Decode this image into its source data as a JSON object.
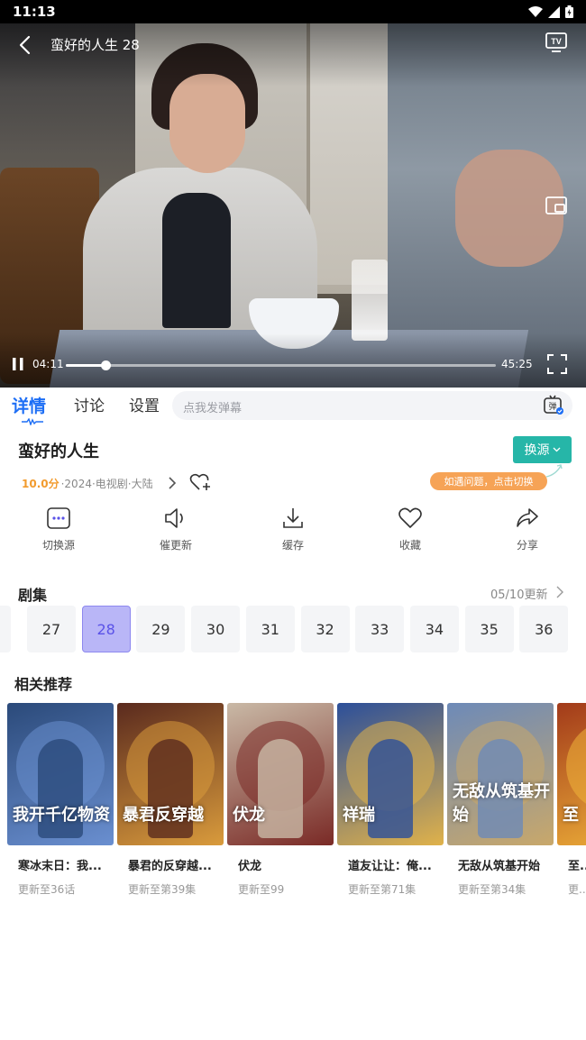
{
  "status_bar": {
    "time": "11:13"
  },
  "player": {
    "title": "蛮好的人生 28",
    "current_time": "04:11",
    "total_time": "45:25",
    "progress": 0.092
  },
  "tabs": {
    "items": [
      {
        "label": "详情",
        "active": true
      },
      {
        "label": "讨论",
        "active": false
      },
      {
        "label": "设置",
        "active": false
      }
    ],
    "danmu_placeholder": "点我发弹幕"
  },
  "show": {
    "title": "蛮好的人生",
    "source_button": "换源",
    "score": "10.0分",
    "meta": "·2024·电视剧·大陆",
    "hint": "如遇问题，点击切换"
  },
  "actions": [
    {
      "label": "切换源",
      "icon": "switch-source-icon"
    },
    {
      "label": "催更新",
      "icon": "speaker-icon"
    },
    {
      "label": "缓存",
      "icon": "download-icon"
    },
    {
      "label": "收藏",
      "icon": "heart-icon"
    },
    {
      "label": "分享",
      "icon": "share-icon"
    }
  ],
  "episodes": {
    "heading": "剧集",
    "update_text": "05/10更新",
    "list": [
      "27",
      "28",
      "29",
      "30",
      "31",
      "32",
      "33",
      "34",
      "35",
      "36"
    ],
    "current": "28"
  },
  "recommendations": {
    "heading": "相关推荐",
    "items": [
      {
        "title": "寒冰末日：我...",
        "subtitle": "更新至36话",
        "poster_text": "我开千亿物资",
        "colors": [
          "#2b4a7a",
          "#6a8fd0"
        ]
      },
      {
        "title": "暴君的反穿越...",
        "subtitle": "更新至第39集",
        "poster_text": "暴君反穿越",
        "colors": [
          "#5a2a1e",
          "#d99b3c"
        ]
      },
      {
        "title": "伏龙",
        "subtitle": "更新至99",
        "poster_text": "伏龙",
        "colors": [
          "#c9b9a6",
          "#7a2a26"
        ]
      },
      {
        "title": "道友让让：俺...",
        "subtitle": "更新至第71集",
        "poster_text": "祥瑞",
        "colors": [
          "#2c4f9a",
          "#e0b24a"
        ]
      },
      {
        "title": "无敌从筑基开始",
        "subtitle": "更新至第34集",
        "poster_text": "无敌从筑基开始",
        "colors": [
          "#6d8ab8",
          "#c9a86a"
        ]
      },
      {
        "title": "至...",
        "subtitle": "更...",
        "poster_text": "至",
        "colors": [
          "#a23a1a",
          "#f0b43a"
        ]
      }
    ]
  }
}
